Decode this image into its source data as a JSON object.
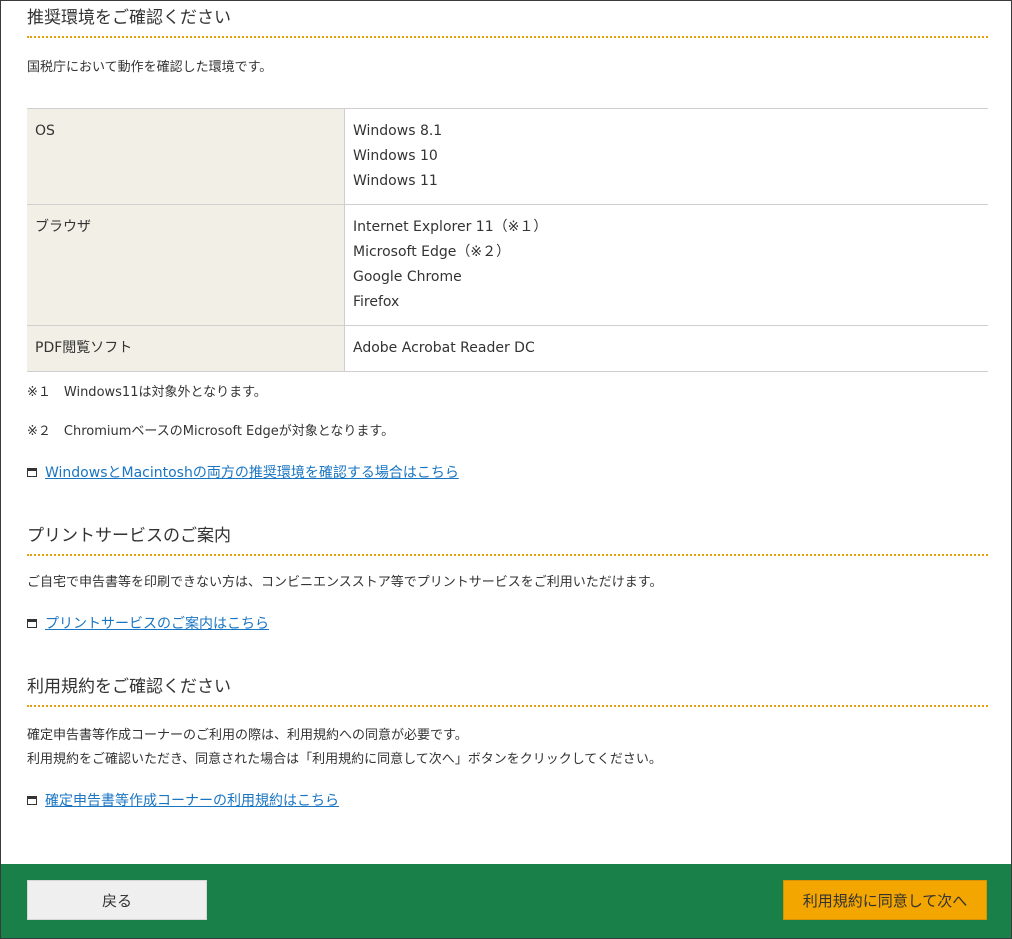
{
  "section_env": {
    "title": "推奨環境をご確認ください",
    "intro": "国税庁において動作を確認した環境です。",
    "table": [
      {
        "label": "OS",
        "values": [
          "Windows 8.1",
          "Windows 10",
          "Windows 11"
        ]
      },
      {
        "label": "ブラウザ",
        "values": [
          "Internet Explorer 11（※１）",
          "Microsoft Edge（※２）",
          "Google Chrome",
          "Firefox"
        ]
      },
      {
        "label": "PDF閲覧ソフト",
        "values": [
          "Adobe Acrobat Reader DC"
        ]
      }
    ],
    "note1": "※１　Windows11は対象外となります。",
    "note2": "※２　ChromiumベースのMicrosoft Edgeが対象となります。",
    "link": "WindowsとMacintoshの両方の推奨環境を確認する場合はこちら"
  },
  "section_print": {
    "title": "プリントサービスのご案内",
    "text": "ご自宅で申告書等を印刷できない方は、コンビニエンスストア等でプリントサービスをご利用いただけます。",
    "link": "プリントサービスのご案内はこちら"
  },
  "section_terms": {
    "title": "利用規約をご確認ください",
    "text1": "確定申告書等作成コーナーのご利用の際は、利用規約への同意が必要です。",
    "text2": "利用規約をご確認いただき、同意された場合は「利用規約に同意して次へ」ボタンをクリックしてください。",
    "link": "確定申告書等作成コーナーの利用規約はこちら"
  },
  "footer": {
    "back_label": "戻る",
    "next_label": "利用規約に同意して次へ"
  },
  "colors": {
    "footer_bg": "#1a8049",
    "next_button": "#f3a500",
    "link": "#1a75c2",
    "title_underline": "#e3a008",
    "table_header_bg": "#f1efe6"
  }
}
